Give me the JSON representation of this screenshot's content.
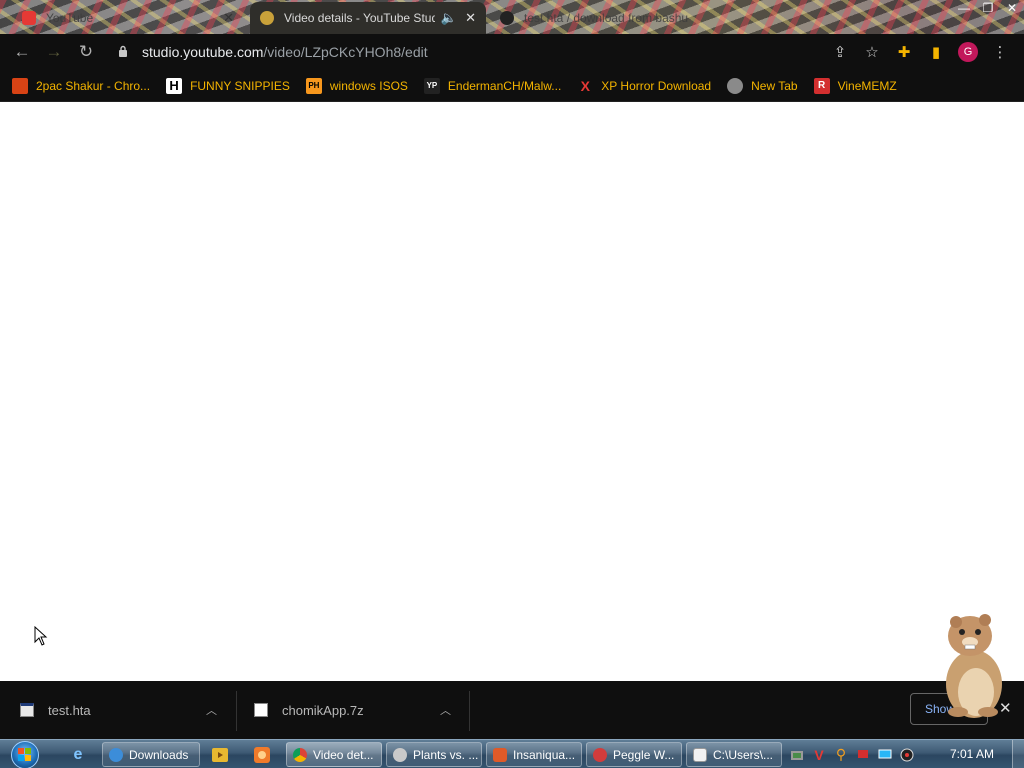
{
  "browser": {
    "tabs": [
      {
        "title": "YouTube",
        "state": "inactive",
        "favicon": "youtube-icon"
      },
      {
        "title": "Video details - YouTube Studio",
        "state": "active",
        "favicon": "youtube-studio-icon",
        "audio": "speaker-icon"
      },
      {
        "title": "test.hta / download from bashu",
        "state": "inactive",
        "favicon": "cloud-icon"
      }
    ],
    "window_controls": [
      "minimize-icon",
      "restore-icon",
      "close-icon"
    ],
    "url": {
      "host": "studio.youtube.com",
      "path": "/video/LZpCKcYHOh8/edit"
    },
    "profile_initial": "G",
    "bookmarks": [
      {
        "label": "2pac Shakur - Chro...",
        "icon": "2pac-icon",
        "icon_text": "",
        "icon_color": "#d84315"
      },
      {
        "label": "FUNNY SNIPPIES",
        "icon": "h-icon",
        "icon_text": "H",
        "icon_color": "#ffffff"
      },
      {
        "label": "windows ISOS",
        "icon": "ph-icon",
        "icon_text": "PH",
        "icon_color": "#f7971d"
      },
      {
        "label": "EndermanCH/Malw...",
        "icon": "yp-icon",
        "icon_text": "YP",
        "icon_color": "#444444"
      },
      {
        "label": "XP Horror Download",
        "icon": "x-icon",
        "icon_text": "X",
        "icon_color": "#e53935"
      },
      {
        "label": "New Tab",
        "icon": "new-tab-icon",
        "icon_text": "",
        "icon_color": "#8a8a8a"
      },
      {
        "label": "VineMEMZ",
        "icon": "r-icon",
        "icon_text": "R",
        "icon_color": "#d32f2f"
      }
    ]
  },
  "downloads": {
    "items": [
      {
        "filename": "test.hta",
        "icon": "hta-file-icon"
      },
      {
        "filename": "chomikApp.7z",
        "icon": "7z-file-icon"
      }
    ],
    "show_all_label": "Show all"
  },
  "taskbar": {
    "buttons": [
      {
        "label": "Downloads",
        "icon": "folder-icon",
        "color": "#3c8dd9"
      },
      {
        "label": "Video det...",
        "icon": "chrome-icon",
        "color": "#e8b830",
        "active": true
      },
      {
        "label": "Plants vs. ...",
        "icon": "plants-vs-zombies-icon",
        "color": "#c9c9c9"
      },
      {
        "label": "Insaniqua...",
        "icon": "insaniquarium-icon",
        "color": "#e05a28"
      },
      {
        "label": "Peggle W...",
        "icon": "peggle-icon",
        "color": "#d23c3c"
      },
      {
        "label": "C:\\Users\\...",
        "icon": "notepad-icon",
        "color": "#f2f2f2"
      }
    ],
    "clock": "7:01 AM"
  },
  "colors": {
    "accent_link": "#8ab4f8",
    "bookmark_text": "#f4b400",
    "avatar": "#c2185b"
  }
}
